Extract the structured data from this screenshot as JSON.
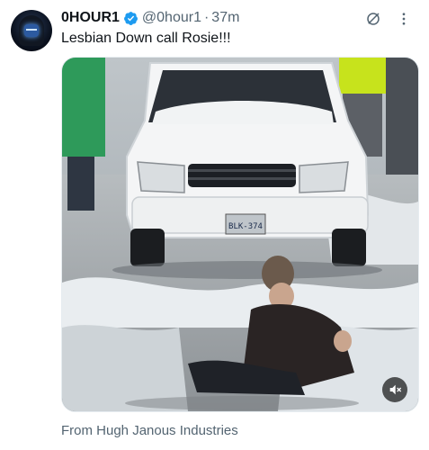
{
  "author": {
    "display_name": "0HOUR1",
    "handle": "@0hour1",
    "separator": "·",
    "time": "37m",
    "verified": true
  },
  "tweet": {
    "text": "Lesbian Down call Rosie!!!",
    "source_label": "From Hugh Janous Industries"
  },
  "media": {
    "type": "video",
    "muted": true,
    "license_plate": "BLK-374"
  },
  "icons": {
    "verified": "verified-badge-icon",
    "grok": "grok-icon",
    "more": "more-dots-icon",
    "mute": "speaker-muted-icon"
  },
  "colors": {
    "text_primary": "#0f1419",
    "text_secondary": "#536471",
    "verified_blue": "#1d9bf0"
  }
}
